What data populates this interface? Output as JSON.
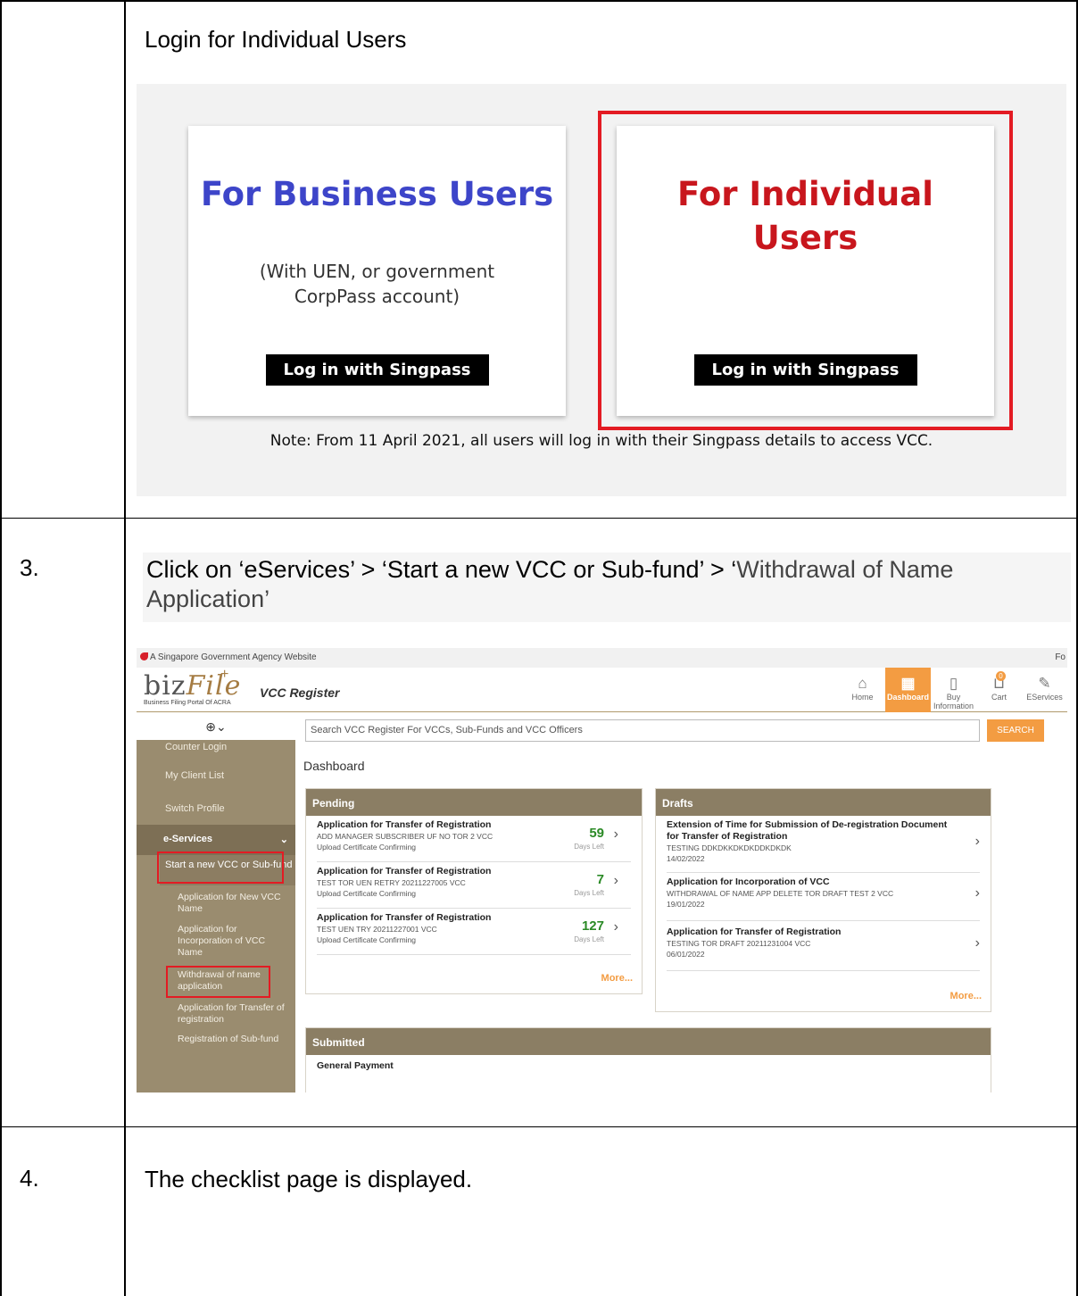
{
  "row1": {
    "text": "Login for Individual Users",
    "login": {
      "business": {
        "title": "For Business Users",
        "subtitle": "(With UEN, or government CorpPass account)",
        "button": "Log in with Singpass"
      },
      "individual": {
        "title": "For Individual Users",
        "button": "Log in with Singpass"
      },
      "note": "Note: From 11 April 2021, all users will log in with their Singpass details to access VCC."
    }
  },
  "row2": {
    "step": "3.",
    "instruction_a": "Click on ‘eServices’ > ‘Start a new VCC or Sub-fund’ > ‘",
    "instruction_b": "Withdrawal of Name Application",
    "instruction_c": "’",
    "app": {
      "gov_banner": "A Singapore Government Agency Website",
      "gov_right": "Fo",
      "logo_text": "biz",
      "logo_file": "File",
      "logo_plus": "+",
      "logo_tag": "Business Filing Portal Of ACRA",
      "app_title": "VCC Register",
      "nav": [
        {
          "label": "Home",
          "icon": "⌂"
        },
        {
          "label": "Dashboard",
          "icon": "▦"
        },
        {
          "label": "Buy Information",
          "icon": "▯"
        },
        {
          "label": "Cart",
          "icon": "⊔"
        },
        {
          "label": "EServices",
          "icon": "✎"
        }
      ],
      "cart_count": "0",
      "search_placeholder": "Search VCC Register For VCCs, Sub-Funds and VCC Officers",
      "search_button": "SEARCH",
      "profile_icon": "⊕⌄",
      "sidebar": {
        "counter_login": "Counter Login",
        "my_client_list": "My Client List",
        "switch_profile": "Switch Profile",
        "eservices": "e-Services",
        "start_new": "Start a new VCC or Sub-fund",
        "children": [
          "Application for New VCC Name",
          "Application for Incorporation of VCC Name",
          "Withdrawal of name application",
          "Application for Transfer of registration",
          "Registration of Sub-fund"
        ]
      },
      "dashboard_title": "Dashboard",
      "pending": {
        "title": "Pending",
        "items": [
          {
            "title": "Application for Transfer of Registration",
            "sub1": "ADD MANAGER SUBSCRIBER UF NO TOR 2 VCC",
            "sub2": "Upload Certificate Confirming",
            "days": "59",
            "days_label": "Days Left"
          },
          {
            "title": "Application for Transfer of Registration",
            "sub1": "TEST TOR UEN RETRY 20211227005 VCC",
            "sub2": "Upload Certificate Confirming",
            "days": "7",
            "days_label": "Days Left"
          },
          {
            "title": "Application for Transfer of Registration",
            "sub1": "TEST UEN TRY 20211227001 VCC",
            "sub2": "Upload Certificate Confirming",
            "days": "127",
            "days_label": "Days Left"
          }
        ],
        "more": "More..."
      },
      "drafts": {
        "title": "Drafts",
        "items": [
          {
            "title": "Extension of Time for Submission of De-registration Document for Transfer of Registration",
            "sub1": "TESTING DDKDKKDKDKDDKDKDK",
            "sub2": "14/02/2022"
          },
          {
            "title": "Application for Incorporation of VCC",
            "sub1": "WITHDRAWAL OF NAME APP DELETE TOR DRAFT TEST 2 VCC",
            "sub2": "19/01/2022"
          },
          {
            "title": "Application for Transfer of Registration",
            "sub1": "TESTING TOR DRAFT 20211231004 VCC",
            "sub2": "06/01/2022"
          }
        ],
        "more": "More..."
      },
      "submitted": {
        "title": "Submitted",
        "first_item": "General Payment"
      }
    }
  },
  "row3": {
    "step": "4.",
    "text": "The checklist page is displayed."
  }
}
